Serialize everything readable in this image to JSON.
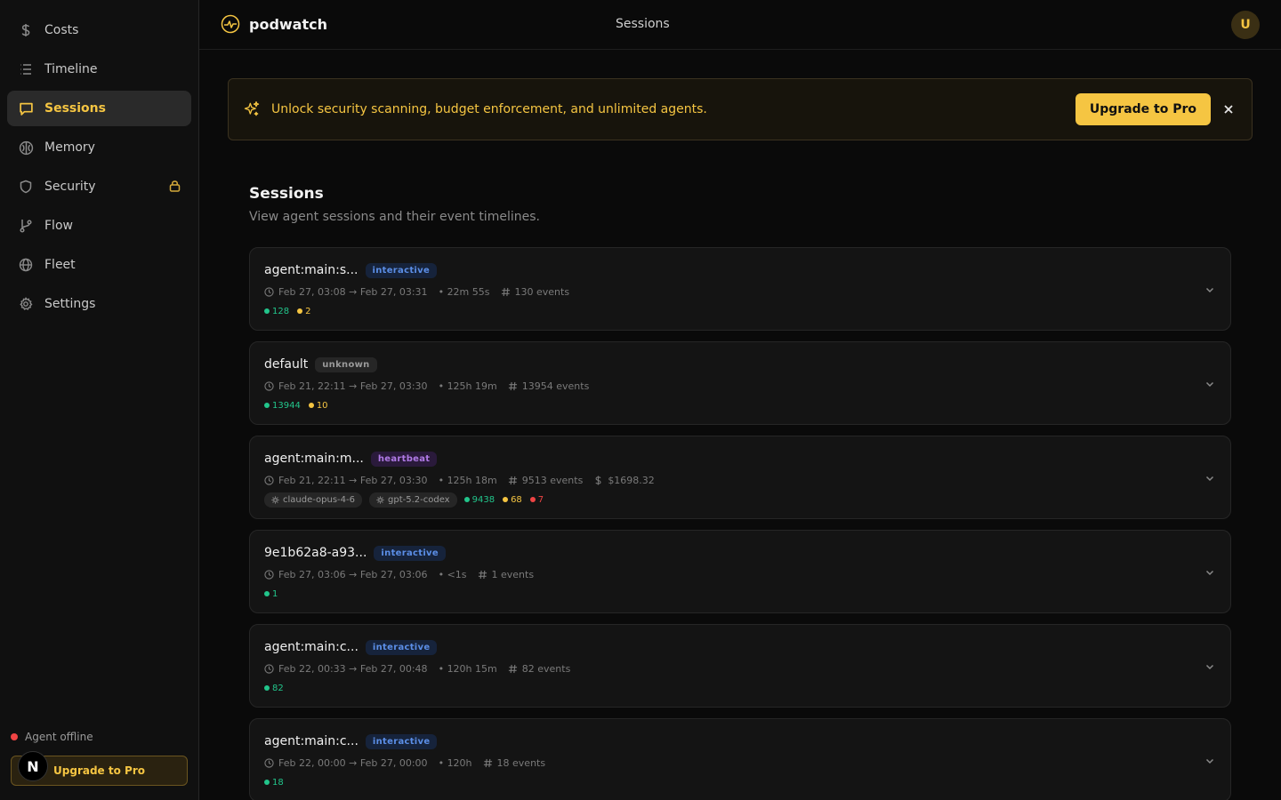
{
  "sidebar": {
    "items": [
      {
        "label": "Costs",
        "icon": "dollar-icon"
      },
      {
        "label": "Timeline",
        "icon": "list-icon"
      },
      {
        "label": "Sessions",
        "icon": "chat-icon"
      },
      {
        "label": "Memory",
        "icon": "brain-icon"
      },
      {
        "label": "Security",
        "icon": "shield-icon"
      },
      {
        "label": "Flow",
        "icon": "branch-icon"
      },
      {
        "label": "Fleet",
        "icon": "globe-icon"
      },
      {
        "label": "Settings",
        "icon": "gear-icon"
      }
    ],
    "active": "Sessions",
    "agent_status": "Agent offline",
    "upgrade_label": "Upgrade to Pro",
    "n_badge": "N"
  },
  "header": {
    "brand": "podwatch",
    "title": "Sessions",
    "avatar_initial": "U"
  },
  "banner": {
    "text": "Unlock security scanning, budget enforcement, and unlimited agents.",
    "button_label": "Upgrade to Pro"
  },
  "page": {
    "title": "Sessions",
    "subtitle": "View agent sessions and their event timelines."
  },
  "sessions": [
    {
      "name": "agent:main:s...",
      "tag": "interactive",
      "start": "Feb 27, 03:08",
      "end": "Feb 27, 03:31",
      "duration": "22m 55s",
      "events": "130 events",
      "cost": "",
      "models": [],
      "counts": [
        {
          "color": "green",
          "value": "128"
        },
        {
          "color": "amber",
          "value": "2"
        }
      ]
    },
    {
      "name": "default",
      "tag": "unknown",
      "start": "Feb 21, 22:11",
      "end": "Feb 27, 03:30",
      "duration": "125h 19m",
      "events": "13954 events",
      "cost": "",
      "models": [],
      "counts": [
        {
          "color": "green",
          "value": "13944"
        },
        {
          "color": "amber",
          "value": "10"
        }
      ]
    },
    {
      "name": "agent:main:m...",
      "tag": "heartbeat",
      "start": "Feb 21, 22:11",
      "end": "Feb 27, 03:30",
      "duration": "125h 18m",
      "events": "9513 events",
      "cost": "$1698.32",
      "models": [
        "claude-opus-4-6",
        "gpt-5.2-codex"
      ],
      "counts": [
        {
          "color": "green",
          "value": "9438"
        },
        {
          "color": "amber",
          "value": "68"
        },
        {
          "color": "red",
          "value": "7"
        }
      ]
    },
    {
      "name": "9e1b62a8-a93...",
      "tag": "interactive",
      "start": "Feb 27, 03:06",
      "end": "Feb 27, 03:06",
      "duration": "<1s",
      "events": "1 events",
      "cost": "",
      "models": [],
      "counts": [
        {
          "color": "green",
          "value": "1"
        }
      ]
    },
    {
      "name": "agent:main:c...",
      "tag": "interactive",
      "start": "Feb 22, 00:33",
      "end": "Feb 27, 00:48",
      "duration": "120h 15m",
      "events": "82 events",
      "cost": "",
      "models": [],
      "counts": [
        {
          "color": "green",
          "value": "82"
        }
      ]
    },
    {
      "name": "agent:main:c...",
      "tag": "interactive",
      "start": "Feb 22, 00:00",
      "end": "Feb 27, 00:00",
      "duration": "120h",
      "events": "18 events",
      "cost": "",
      "models": [],
      "counts": [
        {
          "color": "green",
          "value": "18"
        }
      ]
    }
  ],
  "colors": {
    "accent": "#f5c542",
    "green": "#22c58b",
    "red": "#ef4444",
    "interactive": "#5b8ee6",
    "heartbeat": "#b07ae6"
  }
}
